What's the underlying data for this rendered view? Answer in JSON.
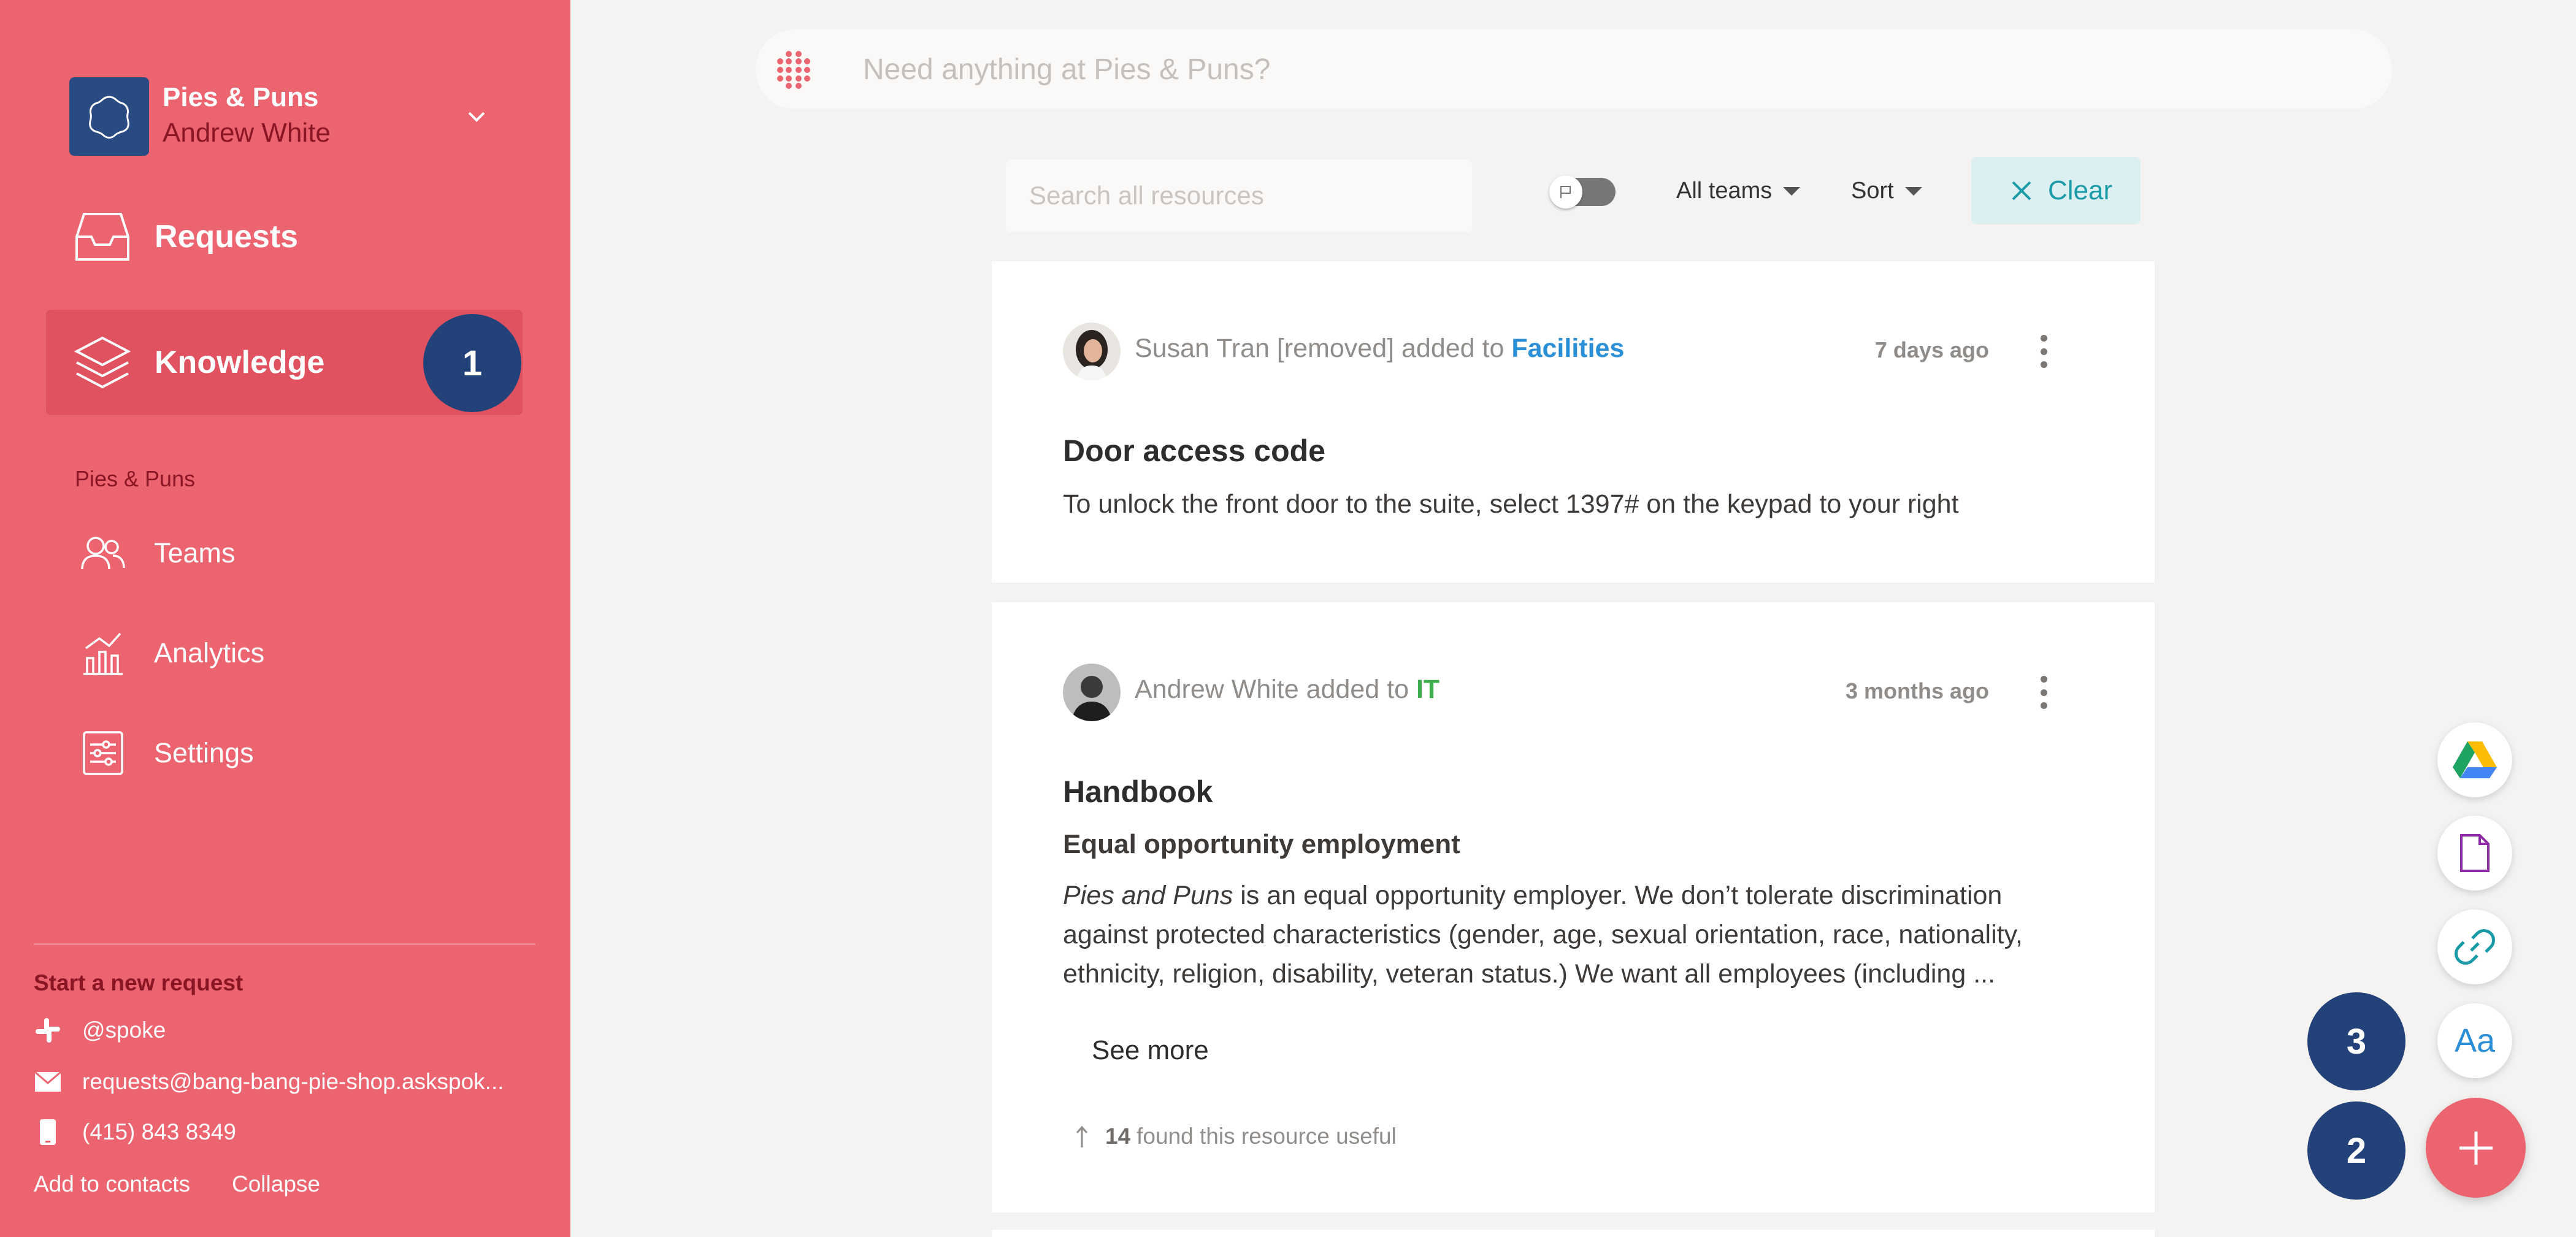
{
  "app": {
    "org_name": "Pies & Puns",
    "user_name": "Andrew White"
  },
  "nav": {
    "requests_label": "Requests",
    "knowledge_label": "Knowledge",
    "section_label": "Pies & Puns",
    "teams_label": "Teams",
    "analytics_label": "Analytics",
    "settings_label": "Settings"
  },
  "badges": {
    "one": "1",
    "two": "2",
    "three": "3"
  },
  "new_request": {
    "heading": "Start a new request",
    "slack": "@spoke",
    "email": "requests@bang-bang-pie-shop.askspok...",
    "phone": "(415) 843 8349",
    "add_contacts": "Add to contacts",
    "collapse": "Collapse"
  },
  "topbar": {
    "placeholder": "Need anything at Pies & Puns?"
  },
  "filters": {
    "search_placeholder": "Search all resources",
    "teams_label": "All teams",
    "sort_label": "Sort",
    "clear_label": "Clear"
  },
  "cards": [
    {
      "author": "Susan Tran [removed] added to ",
      "team": "Facilities",
      "time": "7 days ago",
      "title": "Door access code",
      "body": "To unlock the front door to the suite, select 1397# on the keypad to your right"
    },
    {
      "author": "Andrew White added to ",
      "team": "IT",
      "time": "3 months ago",
      "title": "Handbook",
      "subtitle": "Equal opportunity employment",
      "body_italic": "Pies and Puns",
      "body": " is an equal opportunity employer. We don’t tolerate discrimination against protected characteristics (gender, age, sexual orientation, race, nationality, ethnicity, religion, disability, veteran status.) We want all employees (including ...",
      "see_more": "See more",
      "useful_count": "14",
      "useful_text": "found this resource useful"
    }
  ],
  "fab": {
    "text_label": "Aa"
  },
  "colors": {
    "sidebar": "#ec6470",
    "badge": "#24427a",
    "facilities": "#2a8fd6",
    "it": "#3fae4f",
    "clear": "#1b9aa8"
  },
  "icons": [
    "chevron-down-icon",
    "inbox-icon",
    "layers-icon",
    "people-icon",
    "analytics-icon",
    "settings-icon",
    "slack-icon",
    "mail-icon",
    "phone-icon",
    "close-icon",
    "google-drive-icon",
    "document-icon",
    "link-icon",
    "plus-icon"
  ]
}
